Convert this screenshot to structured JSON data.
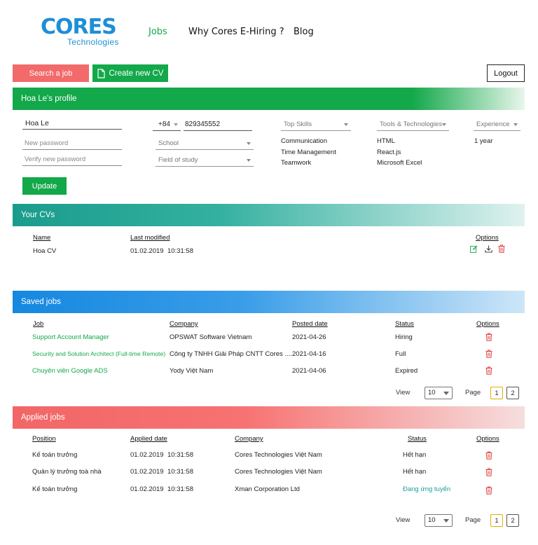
{
  "header": {
    "logo_main": "CORES",
    "logo_sub": "Technologies",
    "nav": [
      "Jobs",
      "Why Cores E-Hiring ?",
      "Blog"
    ]
  },
  "actions": {
    "search_job": "Search a job",
    "create_cv": "Create new CV",
    "logout": "Logout"
  },
  "profile": {
    "title": "Hoa Le's profile",
    "name": "Hoa Le",
    "phone_code": "+84",
    "phone": "829345552",
    "new_password_placeholder": "New password",
    "verify_password_placeholder": "Verify new password",
    "school_placeholder": "School",
    "field_placeholder": "Field of study",
    "top_skills_label": "Top Skills",
    "top_skills": [
      "Communication",
      "Time Management",
      "Teamwork"
    ],
    "tools_label": "Tools & Technologies",
    "tools": [
      "HTML",
      "React.js",
      "Microsoft Excel"
    ],
    "experience_label": "Experience",
    "experience": "1 year",
    "update": "Update"
  },
  "cvs": {
    "title": "Your CVs",
    "headers": [
      "Name",
      "Last modified",
      "Options"
    ],
    "rows": [
      {
        "name": "Hoa CV",
        "date": "01.02.2019",
        "time": "10:31:58"
      }
    ]
  },
  "saved_jobs": {
    "title": "Saved jobs",
    "headers": [
      "Job",
      "Company",
      "Posted date",
      "Status",
      "Options"
    ],
    "rows": [
      {
        "job": "Support Account Manager",
        "company": "OPSWAT Software Vietnam",
        "date": "2021-04-26",
        "status": "Hiring"
      },
      {
        "job": "Security and Solution Architect (Full-time Remote)",
        "company": "Công ty TNHH Giải Pháp CNTT Cores ....",
        "date": "2021-04-16",
        "status": "Full"
      },
      {
        "job": "Chuyên viên Google ADS",
        "company": "Yody Việt Nam",
        "date": "2021-04-06",
        "status": "Expired"
      }
    ],
    "pagination": {
      "view_label": "View",
      "view_value": "10",
      "page_label": "Page",
      "pages": [
        "1",
        "2"
      ],
      "current": "1"
    }
  },
  "applied_jobs": {
    "title": "Applied jobs",
    "headers": [
      "Position",
      "Applied date",
      "Company",
      "Status",
      "Options"
    ],
    "rows": [
      {
        "position": "Kế toán trưởng",
        "date": "01.02.2019",
        "time": "10:31:58",
        "company": "Cores Technologies Việt Nam",
        "status": "Hết hạn"
      },
      {
        "position": "Quản lý trưởng toà nhà",
        "date": "01.02.2019",
        "time": "10:31:58",
        "company": "Cores Technologies Việt Nam",
        "status": "Hết hạn"
      },
      {
        "position": "Kế toán trưởng",
        "date": "01.02.2019",
        "time": "10:31:58",
        "company": "Xman Corporation Ltd",
        "status": "Đang ứng tuyển"
      }
    ],
    "pagination": {
      "view_label": "View",
      "view_value": "10",
      "page_label": "Page",
      "pages": [
        "1",
        "2"
      ],
      "current": "1"
    }
  },
  "colors": {
    "brand_blue": "#1e8fd6",
    "green": "#13a84a",
    "red": "#f26a6a",
    "teal": "#1a9c8c",
    "blue": "#1588e0",
    "delete_icon": "#e03b3b"
  },
  "icons": {
    "create_cv": "document-icon",
    "edit": "edit-icon",
    "download": "download-icon",
    "delete": "trash-icon"
  }
}
